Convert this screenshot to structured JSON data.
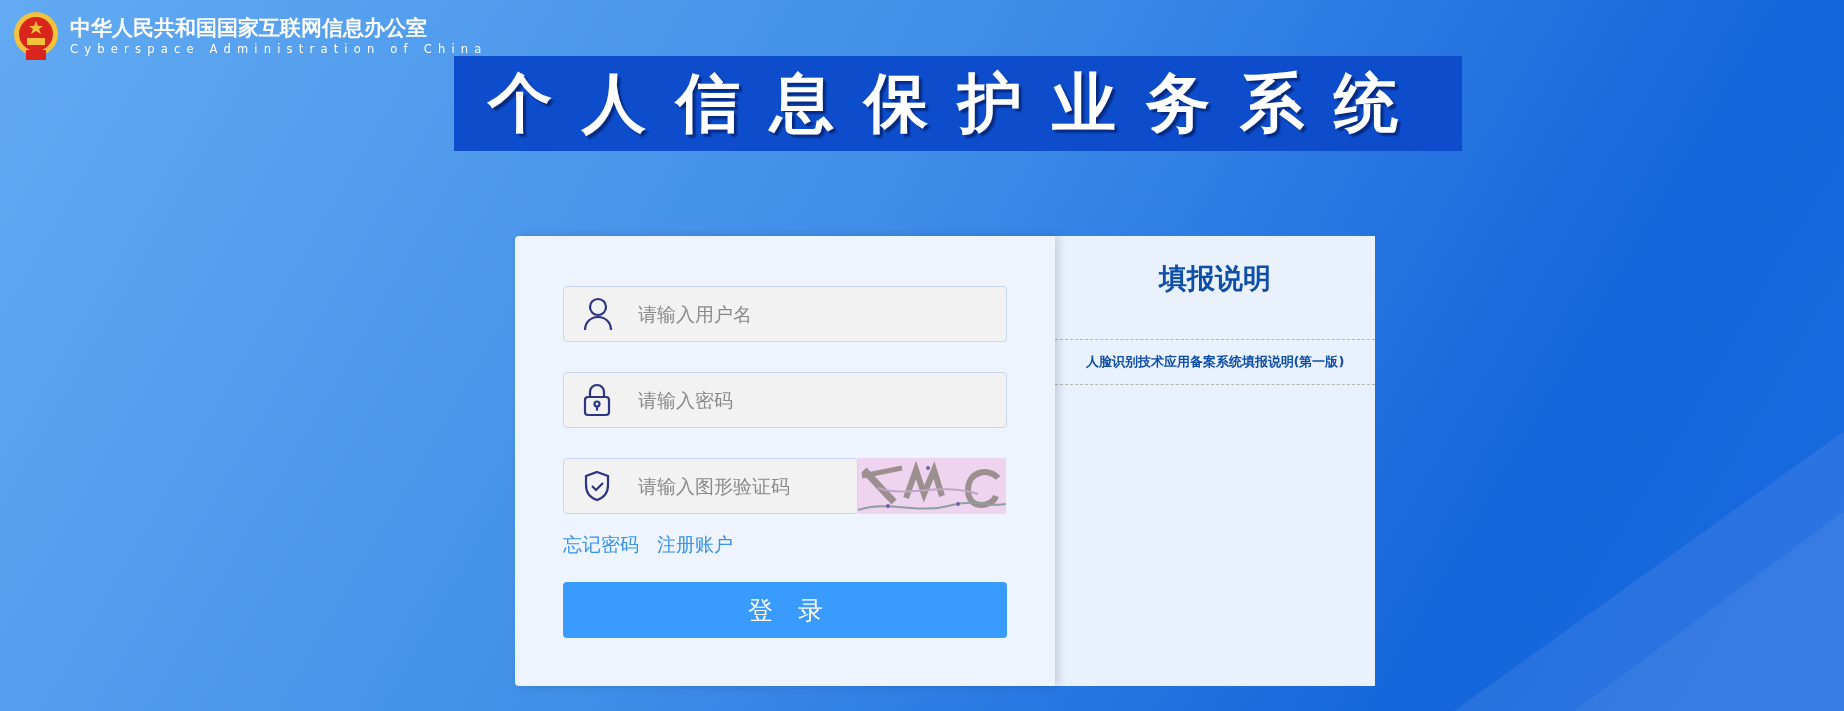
{
  "header": {
    "title": "中华人民共和国国家互联网信息办公室",
    "subtitle": "Cyberspace Administration of China"
  },
  "banner": {
    "title": "个人信息保护业务系统"
  },
  "login": {
    "fields": [
      {
        "kind": "user",
        "placeholder": "请输入用户名"
      },
      {
        "kind": "password",
        "placeholder": "请输入密码"
      },
      {
        "kind": "captcha",
        "placeholder": "请输入图形验证码"
      }
    ],
    "links": [
      "忘记密码",
      "注册账户"
    ],
    "button": "登　录"
  },
  "notice": {
    "title": "填报说明",
    "items": [
      "人脸识别技术应用备案系统填报说明(第一版)"
    ]
  }
}
